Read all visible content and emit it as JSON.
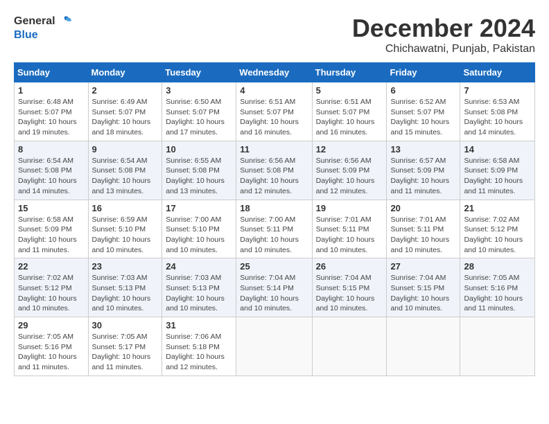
{
  "logo": {
    "general": "General",
    "blue": "Blue"
  },
  "title": "December 2024",
  "subtitle": "Chichawatni, Punjab, Pakistan",
  "days_of_week": [
    "Sunday",
    "Monday",
    "Tuesday",
    "Wednesday",
    "Thursday",
    "Friday",
    "Saturday"
  ],
  "weeks": [
    [
      {
        "day": "1",
        "info": "Sunrise: 6:48 AM\nSunset: 5:07 PM\nDaylight: 10 hours and 19 minutes."
      },
      {
        "day": "2",
        "info": "Sunrise: 6:49 AM\nSunset: 5:07 PM\nDaylight: 10 hours and 18 minutes."
      },
      {
        "day": "3",
        "info": "Sunrise: 6:50 AM\nSunset: 5:07 PM\nDaylight: 10 hours and 17 minutes."
      },
      {
        "day": "4",
        "info": "Sunrise: 6:51 AM\nSunset: 5:07 PM\nDaylight: 10 hours and 16 minutes."
      },
      {
        "day": "5",
        "info": "Sunrise: 6:51 AM\nSunset: 5:07 PM\nDaylight: 10 hours and 16 minutes."
      },
      {
        "day": "6",
        "info": "Sunrise: 6:52 AM\nSunset: 5:07 PM\nDaylight: 10 hours and 15 minutes."
      },
      {
        "day": "7",
        "info": "Sunrise: 6:53 AM\nSunset: 5:08 PM\nDaylight: 10 hours and 14 minutes."
      }
    ],
    [
      {
        "day": "8",
        "info": "Sunrise: 6:54 AM\nSunset: 5:08 PM\nDaylight: 10 hours and 14 minutes."
      },
      {
        "day": "9",
        "info": "Sunrise: 6:54 AM\nSunset: 5:08 PM\nDaylight: 10 hours and 13 minutes."
      },
      {
        "day": "10",
        "info": "Sunrise: 6:55 AM\nSunset: 5:08 PM\nDaylight: 10 hours and 13 minutes."
      },
      {
        "day": "11",
        "info": "Sunrise: 6:56 AM\nSunset: 5:08 PM\nDaylight: 10 hours and 12 minutes."
      },
      {
        "day": "12",
        "info": "Sunrise: 6:56 AM\nSunset: 5:09 PM\nDaylight: 10 hours and 12 minutes."
      },
      {
        "day": "13",
        "info": "Sunrise: 6:57 AM\nSunset: 5:09 PM\nDaylight: 10 hours and 11 minutes."
      },
      {
        "day": "14",
        "info": "Sunrise: 6:58 AM\nSunset: 5:09 PM\nDaylight: 10 hours and 11 minutes."
      }
    ],
    [
      {
        "day": "15",
        "info": "Sunrise: 6:58 AM\nSunset: 5:09 PM\nDaylight: 10 hours and 11 minutes."
      },
      {
        "day": "16",
        "info": "Sunrise: 6:59 AM\nSunset: 5:10 PM\nDaylight: 10 hours and 10 minutes."
      },
      {
        "day": "17",
        "info": "Sunrise: 7:00 AM\nSunset: 5:10 PM\nDaylight: 10 hours and 10 minutes."
      },
      {
        "day": "18",
        "info": "Sunrise: 7:00 AM\nSunset: 5:11 PM\nDaylight: 10 hours and 10 minutes."
      },
      {
        "day": "19",
        "info": "Sunrise: 7:01 AM\nSunset: 5:11 PM\nDaylight: 10 hours and 10 minutes."
      },
      {
        "day": "20",
        "info": "Sunrise: 7:01 AM\nSunset: 5:11 PM\nDaylight: 10 hours and 10 minutes."
      },
      {
        "day": "21",
        "info": "Sunrise: 7:02 AM\nSunset: 5:12 PM\nDaylight: 10 hours and 10 minutes."
      }
    ],
    [
      {
        "day": "22",
        "info": "Sunrise: 7:02 AM\nSunset: 5:12 PM\nDaylight: 10 hours and 10 minutes."
      },
      {
        "day": "23",
        "info": "Sunrise: 7:03 AM\nSunset: 5:13 PM\nDaylight: 10 hours and 10 minutes."
      },
      {
        "day": "24",
        "info": "Sunrise: 7:03 AM\nSunset: 5:13 PM\nDaylight: 10 hours and 10 minutes."
      },
      {
        "day": "25",
        "info": "Sunrise: 7:04 AM\nSunset: 5:14 PM\nDaylight: 10 hours and 10 minutes."
      },
      {
        "day": "26",
        "info": "Sunrise: 7:04 AM\nSunset: 5:15 PM\nDaylight: 10 hours and 10 minutes."
      },
      {
        "day": "27",
        "info": "Sunrise: 7:04 AM\nSunset: 5:15 PM\nDaylight: 10 hours and 10 minutes."
      },
      {
        "day": "28",
        "info": "Sunrise: 7:05 AM\nSunset: 5:16 PM\nDaylight: 10 hours and 11 minutes."
      }
    ],
    [
      {
        "day": "29",
        "info": "Sunrise: 7:05 AM\nSunset: 5:16 PM\nDaylight: 10 hours and 11 minutes."
      },
      {
        "day": "30",
        "info": "Sunrise: 7:05 AM\nSunset: 5:17 PM\nDaylight: 10 hours and 11 minutes."
      },
      {
        "day": "31",
        "info": "Sunrise: 7:06 AM\nSunset: 5:18 PM\nDaylight: 10 hours and 12 minutes."
      },
      {
        "day": "",
        "info": ""
      },
      {
        "day": "",
        "info": ""
      },
      {
        "day": "",
        "info": ""
      },
      {
        "day": "",
        "info": ""
      }
    ]
  ]
}
